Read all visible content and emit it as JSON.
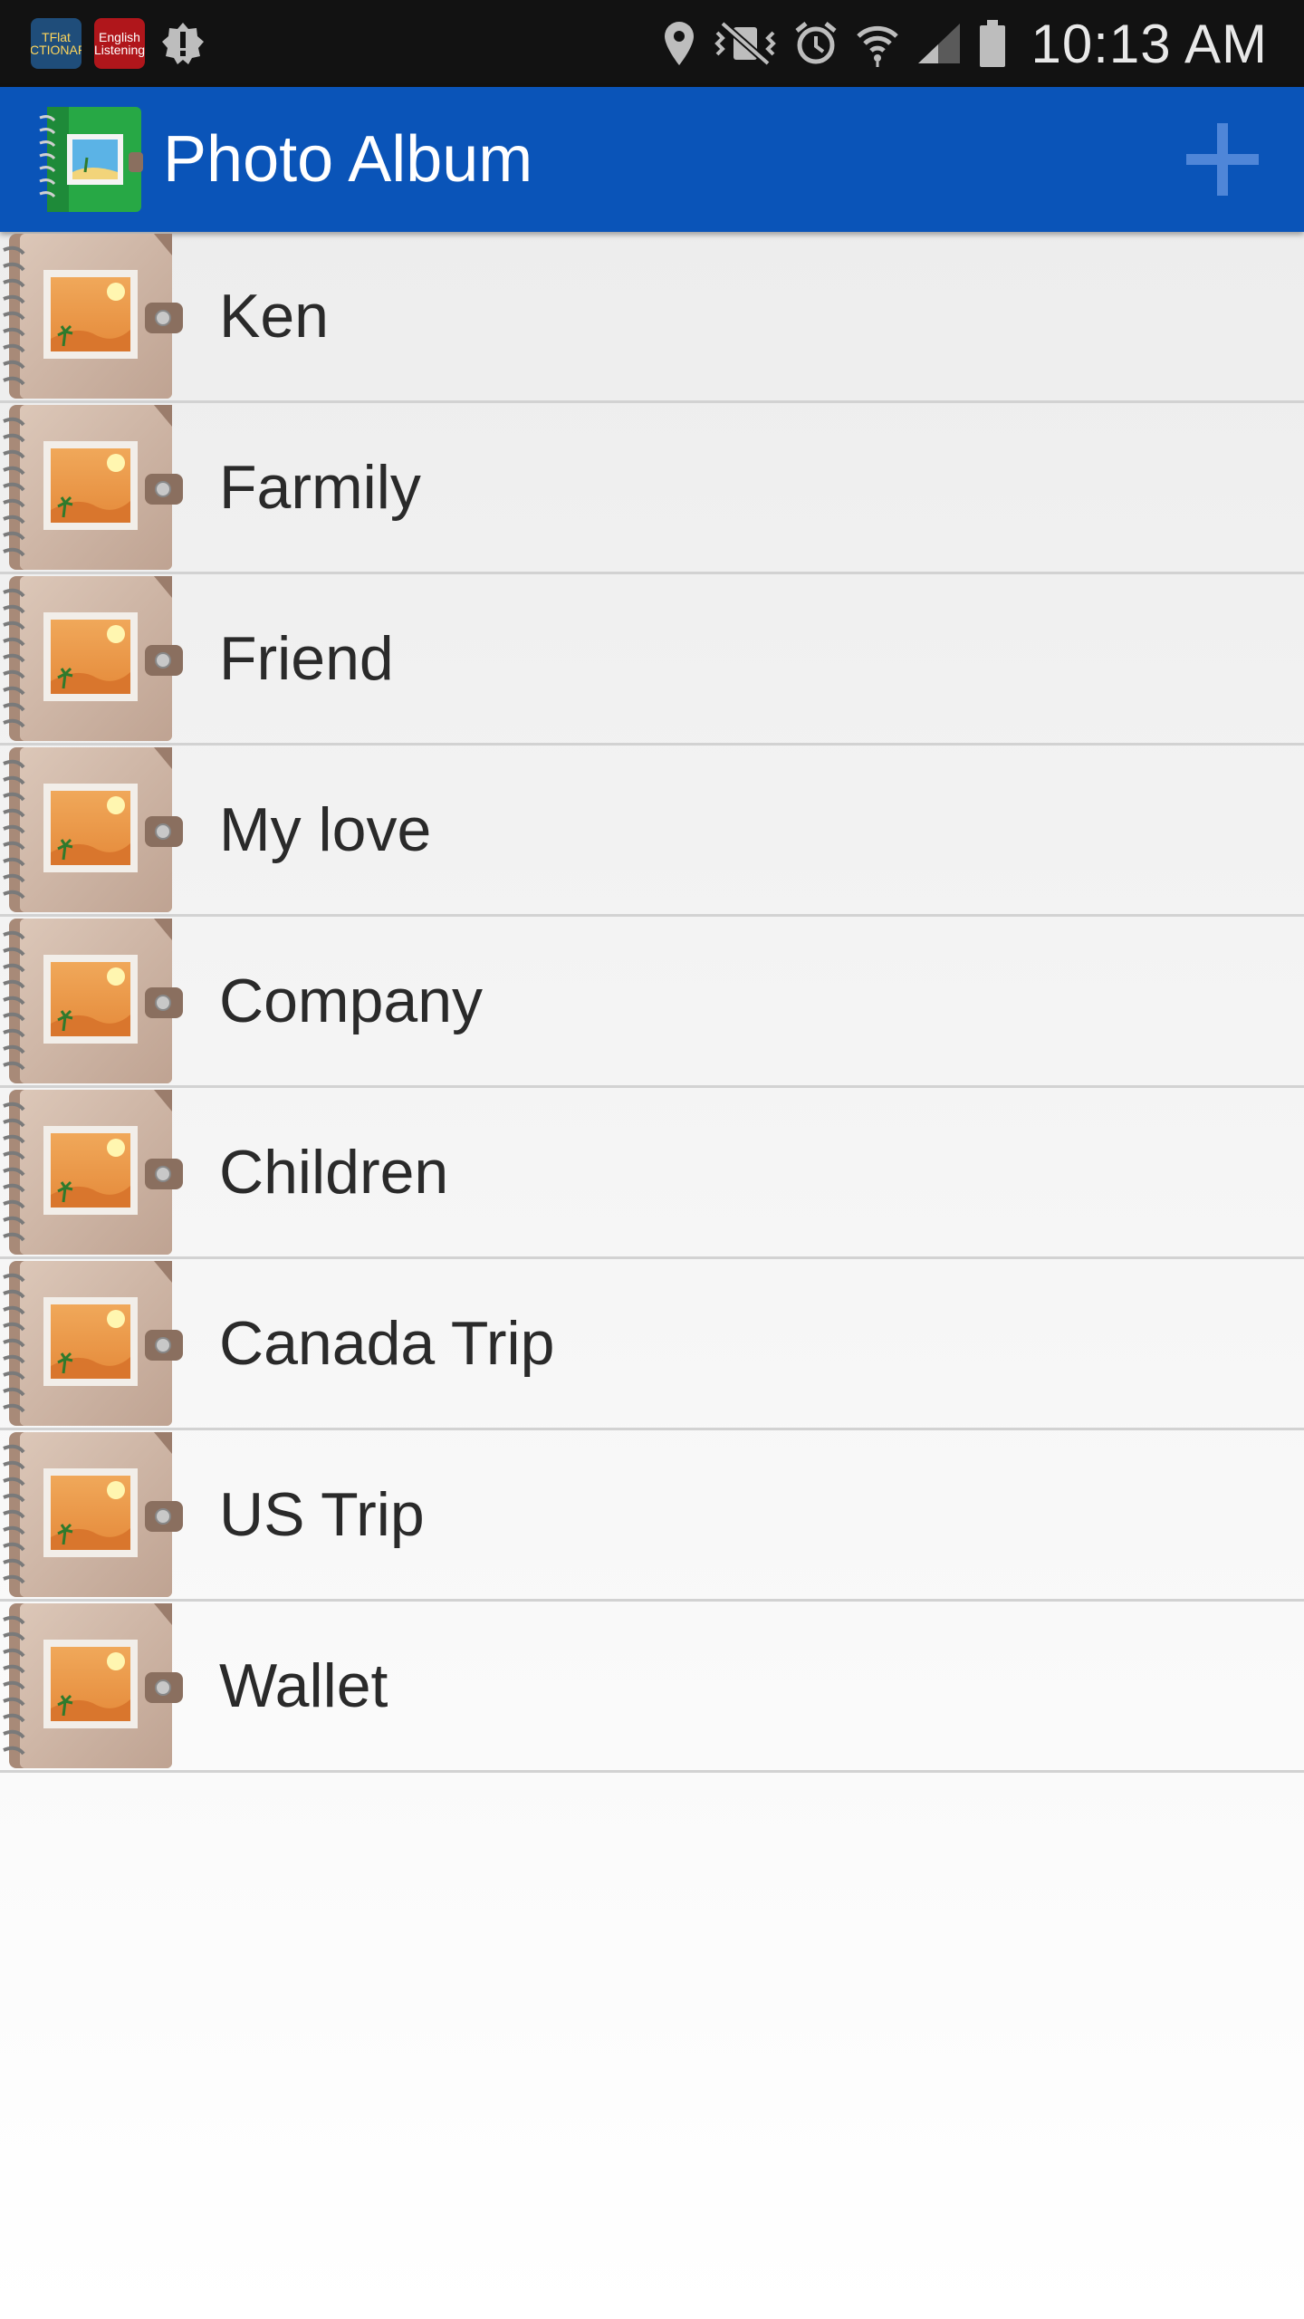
{
  "status_bar": {
    "notifications": [
      {
        "name": "tflat-dictionary-icon",
        "text": "TFlat DICTIONARY"
      },
      {
        "name": "english-listening-icon",
        "text": "English Listening"
      },
      {
        "name": "alert-icon",
        "text": ""
      }
    ],
    "indicators": [
      "location-icon",
      "vibrate-mute-icon",
      "alarm-icon",
      "wifi-icon",
      "signal-icon",
      "battery-icon"
    ],
    "time": "10:13 AM"
  },
  "app_bar": {
    "title": "Photo Album",
    "add_icon": "plus-icon",
    "color": "#0a54b8"
  },
  "albums": [
    {
      "label": "Ken"
    },
    {
      "label": "Farmily"
    },
    {
      "label": "Friend"
    },
    {
      "label": "My love"
    },
    {
      "label": "Company"
    },
    {
      "label": "Children"
    },
    {
      "label": "Canada Trip"
    },
    {
      "label": "US Trip"
    },
    {
      "label": "Wallet"
    }
  ]
}
